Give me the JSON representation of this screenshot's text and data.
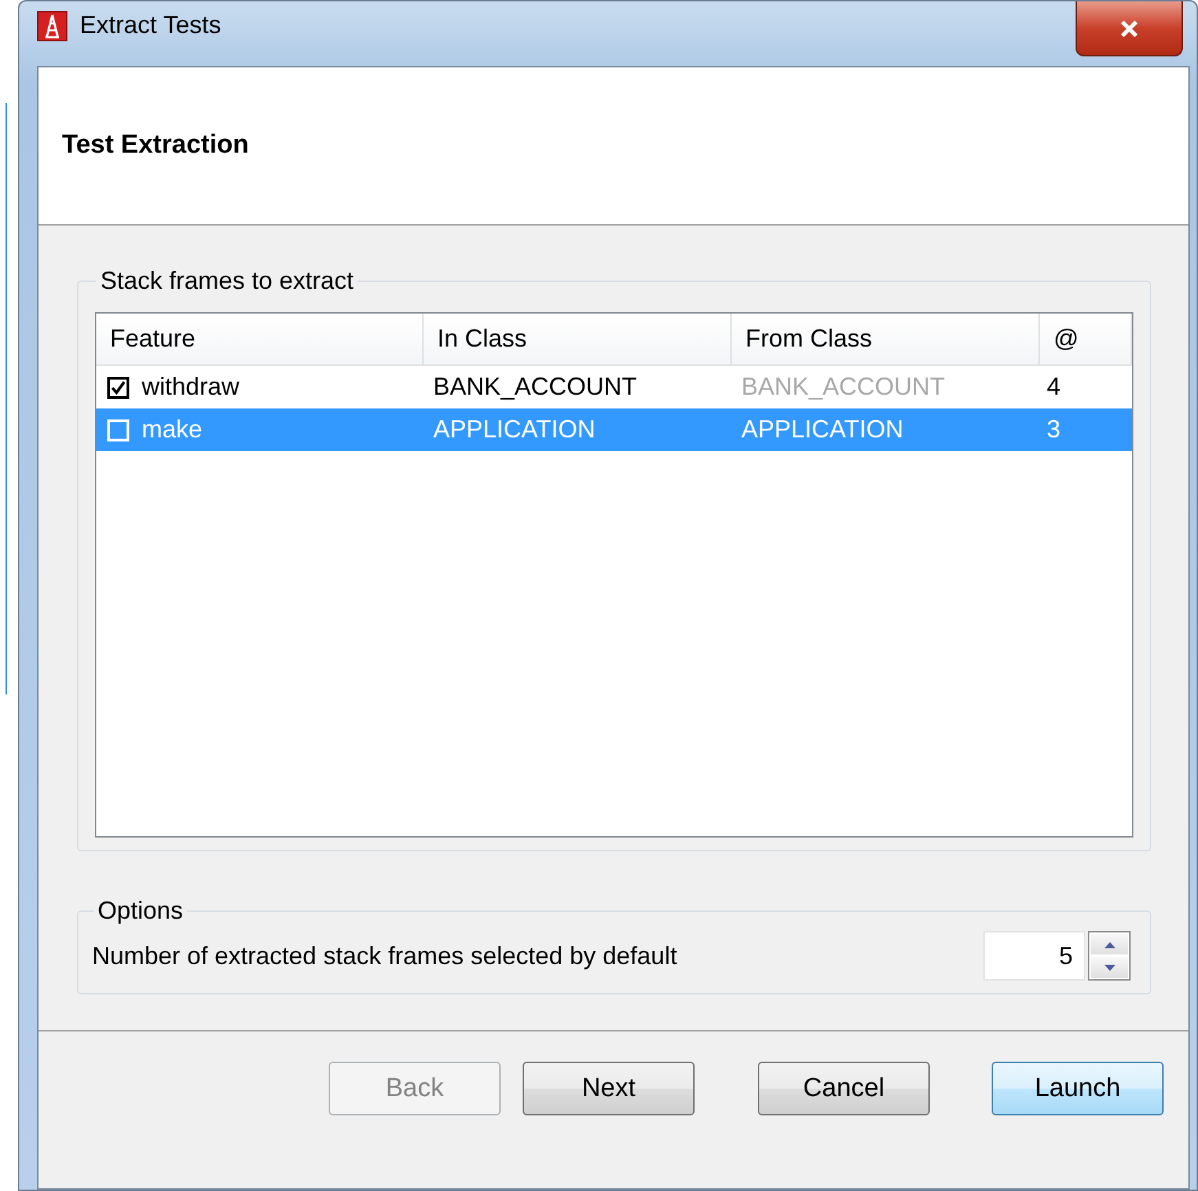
{
  "window": {
    "title": "Extract Tests"
  },
  "header": {
    "title": "Test Extraction"
  },
  "frames_group": {
    "title": "Stack frames to extract",
    "table": {
      "columns": [
        "Feature",
        "In Class",
        "From Class",
        "@"
      ],
      "rows": [
        {
          "checked": true,
          "selected": false,
          "feature": "withdraw",
          "in_class": "BANK_ACCOUNT",
          "from_class": "BANK_ACCOUNT",
          "from_class_disabled": true,
          "at": "4"
        },
        {
          "checked": false,
          "selected": true,
          "feature": "make",
          "in_class": "APPLICATION",
          "from_class": "APPLICATION",
          "from_class_disabled": false,
          "at": "3"
        }
      ]
    }
  },
  "options_group": {
    "title": "Options",
    "label": "Number of extracted stack frames selected by default",
    "value": "5"
  },
  "buttons": [
    {
      "label": "Back",
      "disabled": true,
      "default": false
    },
    {
      "label": "Next",
      "disabled": false,
      "default": false
    },
    {
      "label": "Cancel",
      "disabled": false,
      "default": false
    },
    {
      "label": "Launch",
      "disabled": false,
      "default": true
    }
  ]
}
